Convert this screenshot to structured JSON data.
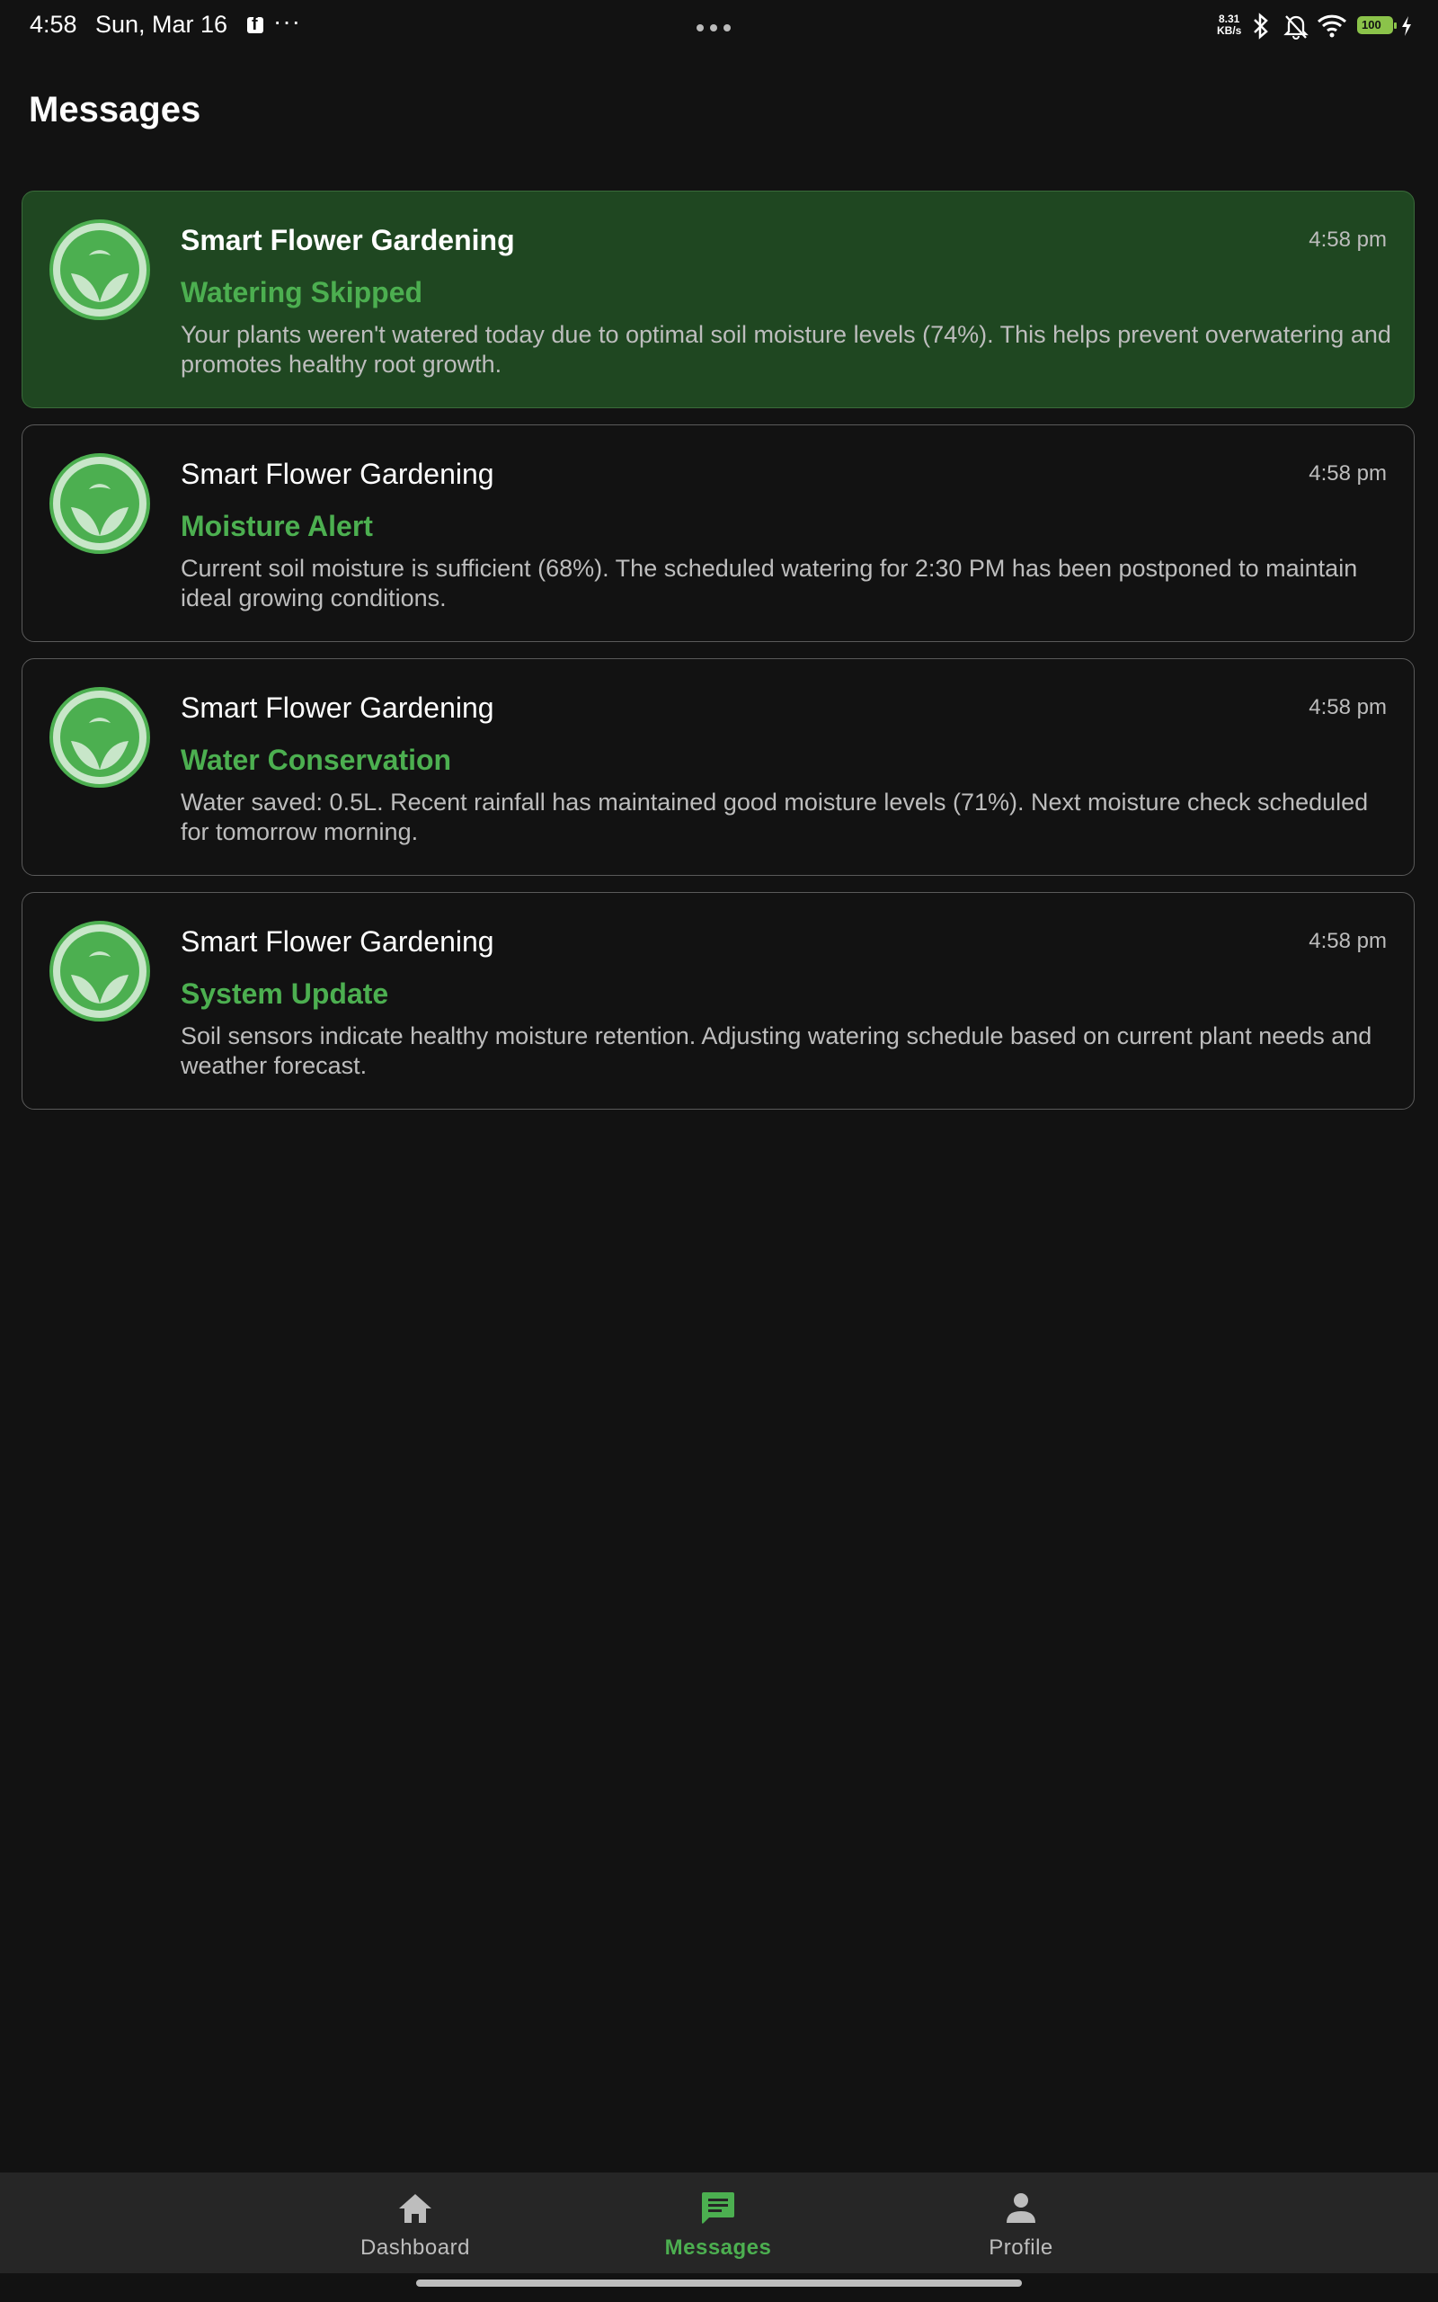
{
  "status_bar": {
    "time": "4:58",
    "date": "Sun, Mar 16",
    "more": "···",
    "network_speed_value": "8.31",
    "network_speed_unit": "KB/s",
    "battery": "100"
  },
  "page": {
    "title": "Messages"
  },
  "messages": [
    {
      "sender": "Smart Flower Gardening",
      "time": "4:58 pm",
      "subject": "Watering Skipped",
      "body": "Your plants weren't watered today due to optimal soil moisture levels (74%). This helps prevent overwatering and promotes healthy root growth."
    },
    {
      "sender": "Smart Flower Gardening",
      "time": "4:58 pm",
      "subject": "Moisture Alert",
      "body": "Current soil moisture is sufficient (68%). The scheduled watering for 2:30 PM has been postponed to maintain ideal growing conditions."
    },
    {
      "sender": "Smart Flower Gardening",
      "time": "4:58 pm",
      "subject": "Water Conservation",
      "body": "Water saved: 0.5L. Recent rainfall has maintained good moisture levels (71%). Next moisture check scheduled for tomorrow morning."
    },
    {
      "sender": "Smart Flower Gardening",
      "time": "4:58 pm",
      "subject": "System Update",
      "body": "Soil sensors indicate healthy moisture retention. Adjusting watering schedule based on current plant needs and weather forecast."
    }
  ],
  "bottom_nav": {
    "items": [
      {
        "label": "Dashboard",
        "icon": "home-icon"
      },
      {
        "label": "Messages",
        "icon": "message-icon"
      },
      {
        "label": "Profile",
        "icon": "person-icon"
      }
    ],
    "active": "Messages"
  },
  "colors": {
    "accent": "#4caf50",
    "background": "#121212",
    "highlight_card": "#1f4721",
    "nav_background": "#262626"
  }
}
